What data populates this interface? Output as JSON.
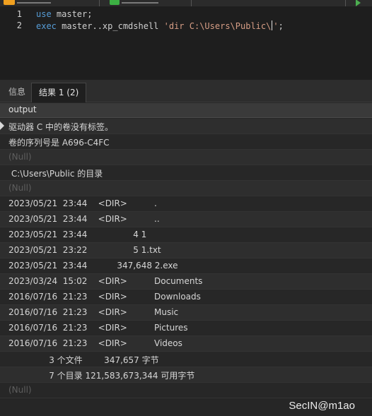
{
  "editor": {
    "lines": [
      {
        "no": "1",
        "kw": "use",
        "rest": " master;"
      },
      {
        "no": "2",
        "kw": "exec",
        "mid": " master..xp_cmdshell ",
        "str": "'dir C:\\Users\\Public\\",
        "str_end": "'",
        "tail": ";"
      }
    ]
  },
  "tabs": {
    "info": "信息",
    "result": "结果 1 (2)"
  },
  "grid": {
    "column": "output",
    "rows": [
      "驱动器 C 中的卷没有标签。",
      "卷的序列号是 A696-C4FC",
      "(Null)",
      " C:\\Users\\Public 的目录",
      "(Null)",
      "2023/05/21  23:44    <DIR>          .",
      "2023/05/21  23:44    <DIR>          ..",
      "2023/05/21  23:44                 4 1",
      "2023/05/21  23:22                 5 1.txt",
      "2023/05/21  23:44           347,648 2.exe",
      "2023/03/24  15:02    <DIR>          Documents",
      "2016/07/16  21:23    <DIR>          Downloads",
      "2016/07/16  21:23    <DIR>          Music",
      "2016/07/16  21:23    <DIR>          Pictures",
      "2016/07/16  21:23    <DIR>          Videos",
      "               3 个文件        347,657 字节",
      "               7 个目录 121,583,673,344 可用字节",
      "(Null)"
    ]
  },
  "watermark": "SecIN@m1ao"
}
